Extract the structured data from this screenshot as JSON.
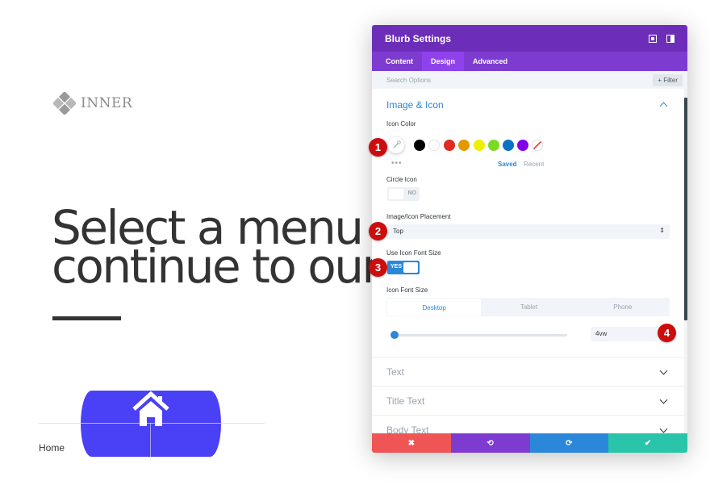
{
  "background_page": {
    "logo_text": "INNER",
    "hero_line1": "Select a menu it",
    "hero_line2": "continue to our w",
    "nav_home": "Home"
  },
  "modal": {
    "title": "Blurb Settings",
    "tabs": [
      {
        "label": "Content",
        "active": false
      },
      {
        "label": "Design",
        "active": true
      },
      {
        "label": "Advanced",
        "active": false
      }
    ],
    "search_placeholder": "Search Options",
    "filter_label": "+ Filter",
    "section_image_icon": "Image & Icon",
    "icon_color_label": "Icon Color",
    "swatches": [
      "#000000",
      "#ffffff",
      "#e02b20",
      "#e09900",
      "#edf000",
      "#7cda24",
      "#0c71c3",
      "#8300e9"
    ],
    "saved_label": "Saved",
    "recent_label": "Recent",
    "circle_icon_label": "Circle Icon",
    "circle_icon_value": "NO",
    "placement_label": "Image/Icon Placement",
    "placement_value": "Top",
    "use_font_size_label": "Use Icon Font Size",
    "use_font_size_value": "YES",
    "icon_font_size_label": "Icon Font Size",
    "device_tabs": [
      "Desktop",
      "Tablet",
      "Phone"
    ],
    "icon_font_size_value": "4vw",
    "collapsed_sections": [
      "Text",
      "Title Text",
      "Body Text"
    ],
    "footer": {
      "cancel": "✖",
      "undo": "⟲",
      "redo": "⟳",
      "save": "✔"
    }
  },
  "colors": {
    "header": "#6c2eb9",
    "tabs_bar": "#7d3bcf",
    "accent_blue": "#2b87da",
    "cancel_red": "#ef5555",
    "undo_purple": "#7e3bd0",
    "redo_blue": "#2b87da",
    "save_green": "#29c4a9",
    "badge_red": "#cc0d0d"
  },
  "badges": [
    "1",
    "2",
    "3",
    "4"
  ]
}
